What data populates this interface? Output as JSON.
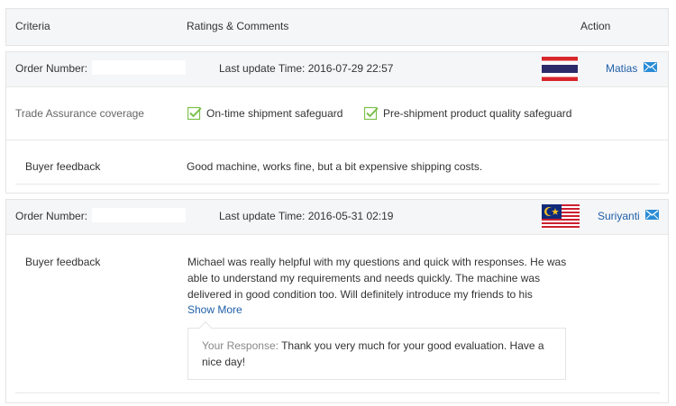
{
  "header": {
    "criteria": "Criteria",
    "ratings": "Ratings & Comments",
    "action": "Action"
  },
  "orders": [
    {
      "order_label": "Order Number:",
      "update_label": "Last update Time: 2016-07-29 22:57",
      "flag": "thailand-flag",
      "buyer": "Matias",
      "trade_assurance_label": "Trade Assurance coverage",
      "safeguards": [
        "On-time shipment safeguard",
        "Pre-shipment product quality safeguard"
      ],
      "feedback_label": "Buyer feedback",
      "feedback": "Good machine, works fine, but a bit expensive shipping costs."
    },
    {
      "order_label": "Order Number:",
      "update_label": "Last update Time: 2016-05-31 02:19",
      "flag": "malaysia-flag",
      "buyer": "Suriyanti",
      "feedback_label": "Buyer feedback",
      "feedback": "Michael was really helpful with my questions and quick with responses. He was able to understand my requirements and needs quickly. The machine was delivered in good condition too. Will definitely introduce my friends to his",
      "show_more": "Show More",
      "response_label": "Your Response:",
      "response": "Thank you very much for your good evaluation. Have a nice day!"
    }
  ],
  "colors": {
    "link": "#1f5fa8",
    "mail_icon": "#2a8cd6",
    "check": "#7cc04b",
    "header_bg": "#f5f6f8"
  }
}
